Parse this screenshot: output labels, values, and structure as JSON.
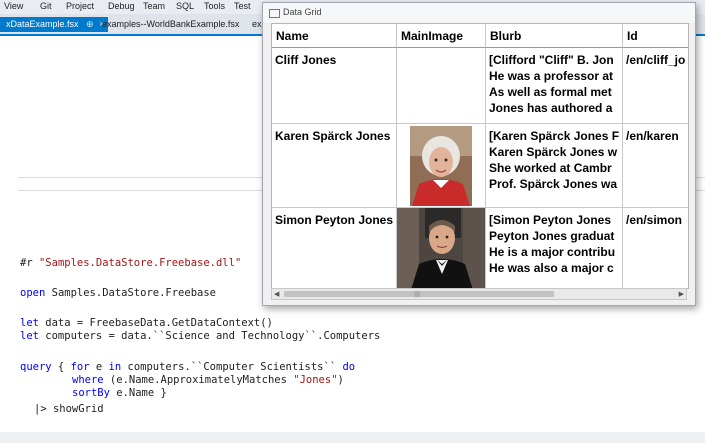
{
  "menu": [
    "View",
    "Git",
    "Project",
    "Debug",
    "Team",
    "SQL",
    "Tools",
    "Test"
  ],
  "tabs": [
    {
      "label": "xDataExample.fsx",
      "pin": "⊕",
      "close": "×"
    },
    {
      "label": "examples--WorldBankExample.fsx"
    },
    {
      "label": "ex"
    }
  ],
  "window": {
    "title": "Data Grid"
  },
  "columns": [
    "Name",
    "MainImage",
    "Blurb",
    "Id"
  ],
  "rows": [
    {
      "name": "Cliff Jones",
      "image": "",
      "blurb": [
        "[Clifford \"Cliff\" B. Jon",
        "He was a professor at",
        "As well as formal met",
        "Jones has authored a"
      ],
      "id": "/en/cliff_jo"
    },
    {
      "name": "Karen Spärck Jones",
      "image": "portrait-woman",
      "blurb": [
        "[Karen Spärck Jones F",
        "Karen Spärck Jones w",
        "She worked at Cambr",
        "Prof. Spärck Jones wa"
      ],
      "id": "/en/karen"
    },
    {
      "name": "Simon Peyton Jones",
      "image": "portrait-man",
      "blurb": [
        "[Simon Peyton Jones",
        "Peyton Jones graduat",
        "He is a major contribu",
        "He was also a major c"
      ],
      "id": "/en/simon"
    }
  ],
  "code": {
    "ref_kw": "#r",
    "ref_str": "\"Samples.DataStore.Freebase.dll\"",
    "open_kw": "open",
    "open_rest": " Samples.DataStore.Freebase",
    "let1_kw": "let",
    "let1_rest": " data = FreebaseData.GetDataContext()",
    "let2_kw": "let",
    "let2_rest": " computers = data.``Science and Technology``.Computers",
    "q1_kw": "query",
    "q1_a": " { ",
    "q1_for": "for",
    "q1_b": " e ",
    "q1_in": "in",
    "q1_c": " computers.``Computer Scientists`` ",
    "q1_do": "do",
    "q2_where": "where",
    "q2_a": " (e.Name.ApproximatelyMatches ",
    "q2_str": "\"Jones\"",
    "q2_b": ")",
    "q3_sort": "sortBy",
    "q3_rest": " e.Name }",
    "q4": "|> showGrid"
  },
  "colors": {
    "accent": "#007acc",
    "keyword": "#0000ff",
    "string": "#a31515"
  }
}
